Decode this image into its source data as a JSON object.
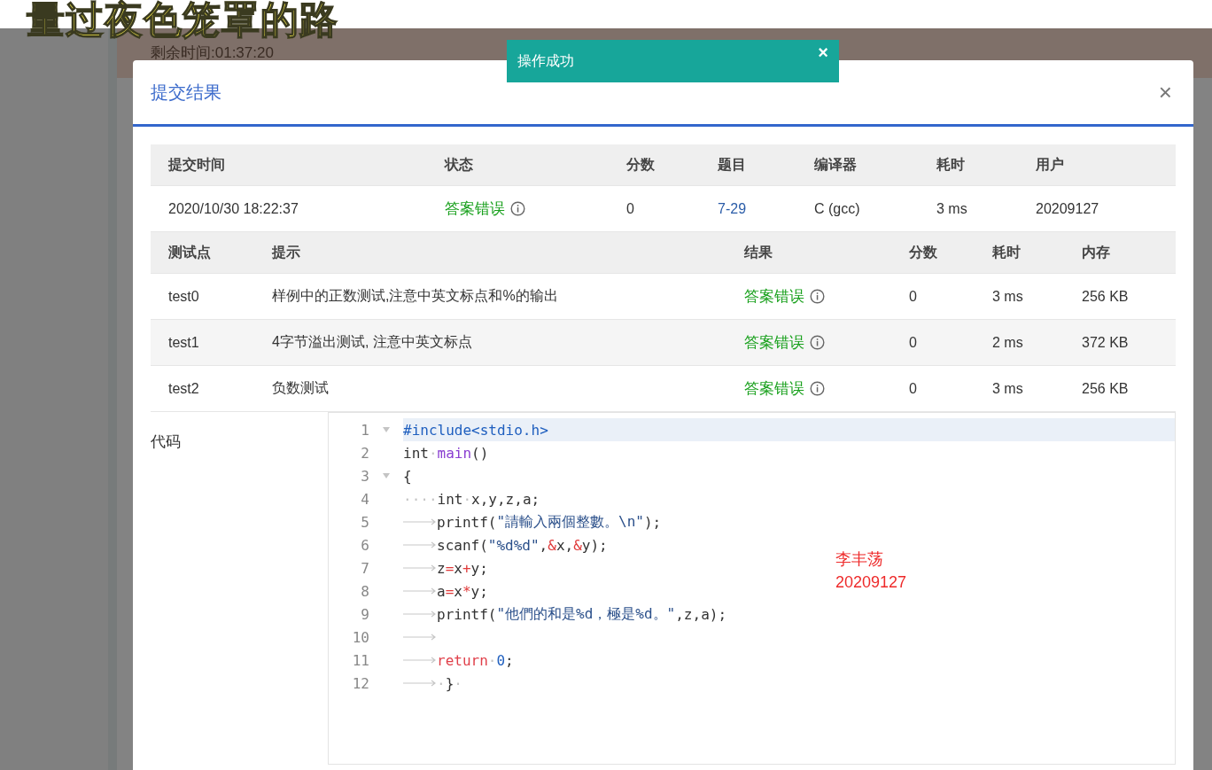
{
  "overlay_lyric": "量过夜色笼罩的路",
  "page": {
    "timer": "剩余时间:01:37:20"
  },
  "toast": {
    "message": "操作成功",
    "close": "×"
  },
  "modal": {
    "title": "提交结果",
    "close": "×",
    "submission": {
      "columns": [
        "提交时间",
        "状态",
        "分数",
        "题目",
        "编译器",
        "耗时",
        "用户"
      ],
      "row": {
        "time": "2020/10/30 18:22:37",
        "status": "答案错误",
        "score": "0",
        "problem": "7-29",
        "compiler": "C (gcc)",
        "duration": "3 ms",
        "user": "20209127"
      }
    },
    "tests": {
      "columns": [
        "测试点",
        "提示",
        "结果",
        "分数",
        "耗时",
        "内存"
      ],
      "rows": [
        {
          "name": "test0",
          "hint": "样例中的正数测试,注意中英文标点和%的输出",
          "result": "答案错误",
          "score": "0",
          "duration": "3 ms",
          "memory": "256 KB"
        },
        {
          "name": "test1",
          "hint": "4字节溢出测试, 注意中英文标点",
          "result": "答案错误",
          "score": "0",
          "duration": "2 ms",
          "memory": "372 KB"
        },
        {
          "name": "test2",
          "hint": "负数测试",
          "result": "答案错误",
          "score": "0",
          "duration": "3 ms",
          "memory": "256 KB"
        }
      ]
    },
    "code": {
      "label": "代码",
      "lines": [
        {
          "number": "1",
          "active": true,
          "foldable": true,
          "tokens": [
            {
              "kind": "directive",
              "t": "#include<stdio.h>"
            }
          ]
        },
        {
          "number": "2",
          "active": false,
          "foldable": false,
          "tokens": [
            {
              "kind": "plain",
              "t": "int"
            },
            {
              "kind": "ws",
              "t": "·"
            },
            {
              "kind": "func",
              "t": "main"
            },
            {
              "kind": "plain",
              "t": "()"
            }
          ]
        },
        {
          "number": "3",
          "active": false,
          "foldable": true,
          "tokens": [
            {
              "kind": "plain",
              "t": "{"
            }
          ]
        },
        {
          "number": "4",
          "active": false,
          "foldable": false,
          "tokens": [
            {
              "kind": "ws",
              "t": "····"
            },
            {
              "kind": "plain",
              "t": "int"
            },
            {
              "kind": "ws",
              "t": "·"
            },
            {
              "kind": "plain",
              "t": "x,y,z,a;"
            }
          ]
        },
        {
          "number": "5",
          "active": false,
          "foldable": false,
          "tokens": [
            {
              "kind": "tab"
            },
            {
              "kind": "plain",
              "t": "printf("
            },
            {
              "kind": "string",
              "t": "\"請輸入兩個整數。\\n\""
            },
            {
              "kind": "plain",
              "t": ");"
            }
          ]
        },
        {
          "number": "6",
          "active": false,
          "foldable": false,
          "tokens": [
            {
              "kind": "tab"
            },
            {
              "kind": "plain",
              "t": "scanf("
            },
            {
              "kind": "string",
              "t": "\"%d%d\""
            },
            {
              "kind": "plain",
              "t": ","
            },
            {
              "kind": "op",
              "t": "&"
            },
            {
              "kind": "plain",
              "t": "x,"
            },
            {
              "kind": "op",
              "t": "&"
            },
            {
              "kind": "plain",
              "t": "y);"
            }
          ]
        },
        {
          "number": "7",
          "active": false,
          "foldable": false,
          "tokens": [
            {
              "kind": "tab"
            },
            {
              "kind": "plain",
              "t": "z"
            },
            {
              "kind": "op",
              "t": "="
            },
            {
              "kind": "plain",
              "t": "x"
            },
            {
              "kind": "op",
              "t": "+"
            },
            {
              "kind": "plain",
              "t": "y;"
            }
          ]
        },
        {
          "number": "8",
          "active": false,
          "foldable": false,
          "tokens": [
            {
              "kind": "tab"
            },
            {
              "kind": "plain",
              "t": "a"
            },
            {
              "kind": "op",
              "t": "="
            },
            {
              "kind": "plain",
              "t": "x"
            },
            {
              "kind": "op",
              "t": "*"
            },
            {
              "kind": "plain",
              "t": "y;"
            }
          ]
        },
        {
          "number": "9",
          "active": false,
          "foldable": false,
          "tokens": [
            {
              "kind": "tab"
            },
            {
              "kind": "plain",
              "t": "printf("
            },
            {
              "kind": "string",
              "t": "\"他們的和是%d，極是%d。\""
            },
            {
              "kind": "plain",
              "t": ",z,a);"
            }
          ]
        },
        {
          "number": "10",
          "active": false,
          "foldable": false,
          "tokens": [
            {
              "kind": "tab"
            }
          ]
        },
        {
          "number": "11",
          "active": false,
          "foldable": false,
          "tokens": [
            {
              "kind": "tab"
            },
            {
              "kind": "keyword",
              "t": "return"
            },
            {
              "kind": "ws",
              "t": "·"
            },
            {
              "kind": "number",
              "t": "0"
            },
            {
              "kind": "plain",
              "t": ";"
            }
          ]
        },
        {
          "number": "12",
          "active": false,
          "foldable": false,
          "tokens": [
            {
              "kind": "tab"
            },
            {
              "kind": "ws",
              "t": "·"
            },
            {
              "kind": "plain",
              "t": "}"
            },
            {
              "kind": "ws",
              "t": "·"
            }
          ]
        }
      ],
      "annotation": [
        "李丰荡",
        "20209127"
      ]
    }
  }
}
